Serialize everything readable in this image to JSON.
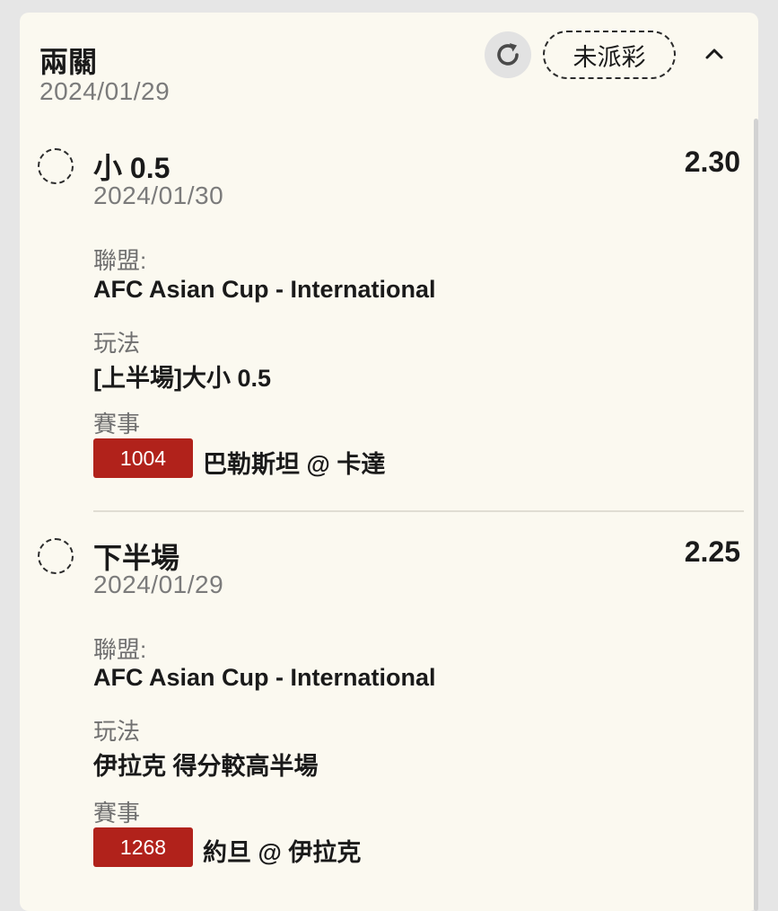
{
  "bet": {
    "type_title": "兩關",
    "date": "2024/01/29",
    "status": "未派彩",
    "icons": {
      "refresh": "refresh-icon",
      "collapse": "chevron-up-icon",
      "radio": "dashed-radio-icon"
    },
    "colors": {
      "card_bg": "#fbf9f0",
      "event_id_bg": "#b1221b",
      "muted_text": "#7b7b7b"
    }
  },
  "legs": [
    {
      "selection": "小 0.5",
      "date": "2024/01/30",
      "odds": "2.30",
      "league_label": "聯盟:",
      "league": "AFC Asian Cup - International",
      "market_label": "玩法",
      "market": "[上半場]大小 0.5",
      "event_label": "賽事",
      "event_id": "1004",
      "event_name": "巴勒斯坦 @ 卡達"
    },
    {
      "selection": "下半場",
      "date": "2024/01/29",
      "odds": "2.25",
      "league_label": "聯盟:",
      "league": "AFC Asian Cup - International",
      "market_label": "玩法",
      "market": "伊拉克 得分較高半場",
      "event_label": "賽事",
      "event_id": "1268",
      "event_name": "約旦 @ 伊拉克"
    }
  ]
}
